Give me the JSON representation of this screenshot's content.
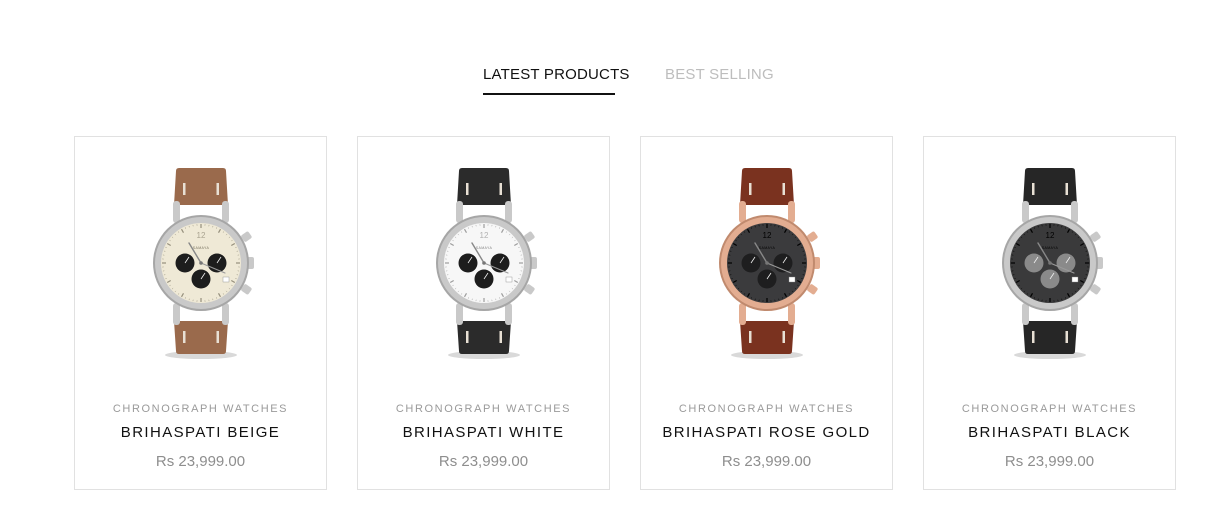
{
  "tabs": {
    "latest_label": "LATEST PRODUCTS",
    "best_label": "BEST SELLING"
  },
  "products": [
    {
      "category": "CHRONOGRAPH WATCHES",
      "title": "BRIHASPATI BEIGE",
      "price": "Rs 23,999.00",
      "strap_color": "#9a6a4c",
      "case_color": "#c9c9c9",
      "dial_color": "#efe9d6",
      "subdial_color": "#1d1d1d",
      "brand_mark": "SAMAYA",
      "dial_number": "12"
    },
    {
      "category": "CHRONOGRAPH WATCHES",
      "title": "BRIHASPATI WHITE",
      "price": "Rs 23,999.00",
      "strap_color": "#2b2b2b",
      "case_color": "#c9c9c9",
      "dial_color": "#f7f7f7",
      "subdial_color": "#1d1d1d",
      "brand_mark": "SAMAYA",
      "dial_number": "12"
    },
    {
      "category": "CHRONOGRAPH WATCHES",
      "title": "BRIHASPATI ROSE GOLD",
      "price": "Rs 23,999.00",
      "strap_color": "#7a321f",
      "case_color": "#e3ad91",
      "dial_color": "#3b3b3d",
      "subdial_color": "#1e1e1f",
      "brand_mark": "SAMAYA",
      "dial_number": "12"
    },
    {
      "category": "CHRONOGRAPH WATCHES",
      "title": "BRIHASPATI BLACK",
      "price": "Rs 23,999.00",
      "strap_color": "#262626",
      "case_color": "#c9c9c9",
      "dial_color": "#3a3a3b",
      "subdial_color": "#8a8a8a",
      "brand_mark": "SAMAYA",
      "dial_number": "12"
    }
  ]
}
